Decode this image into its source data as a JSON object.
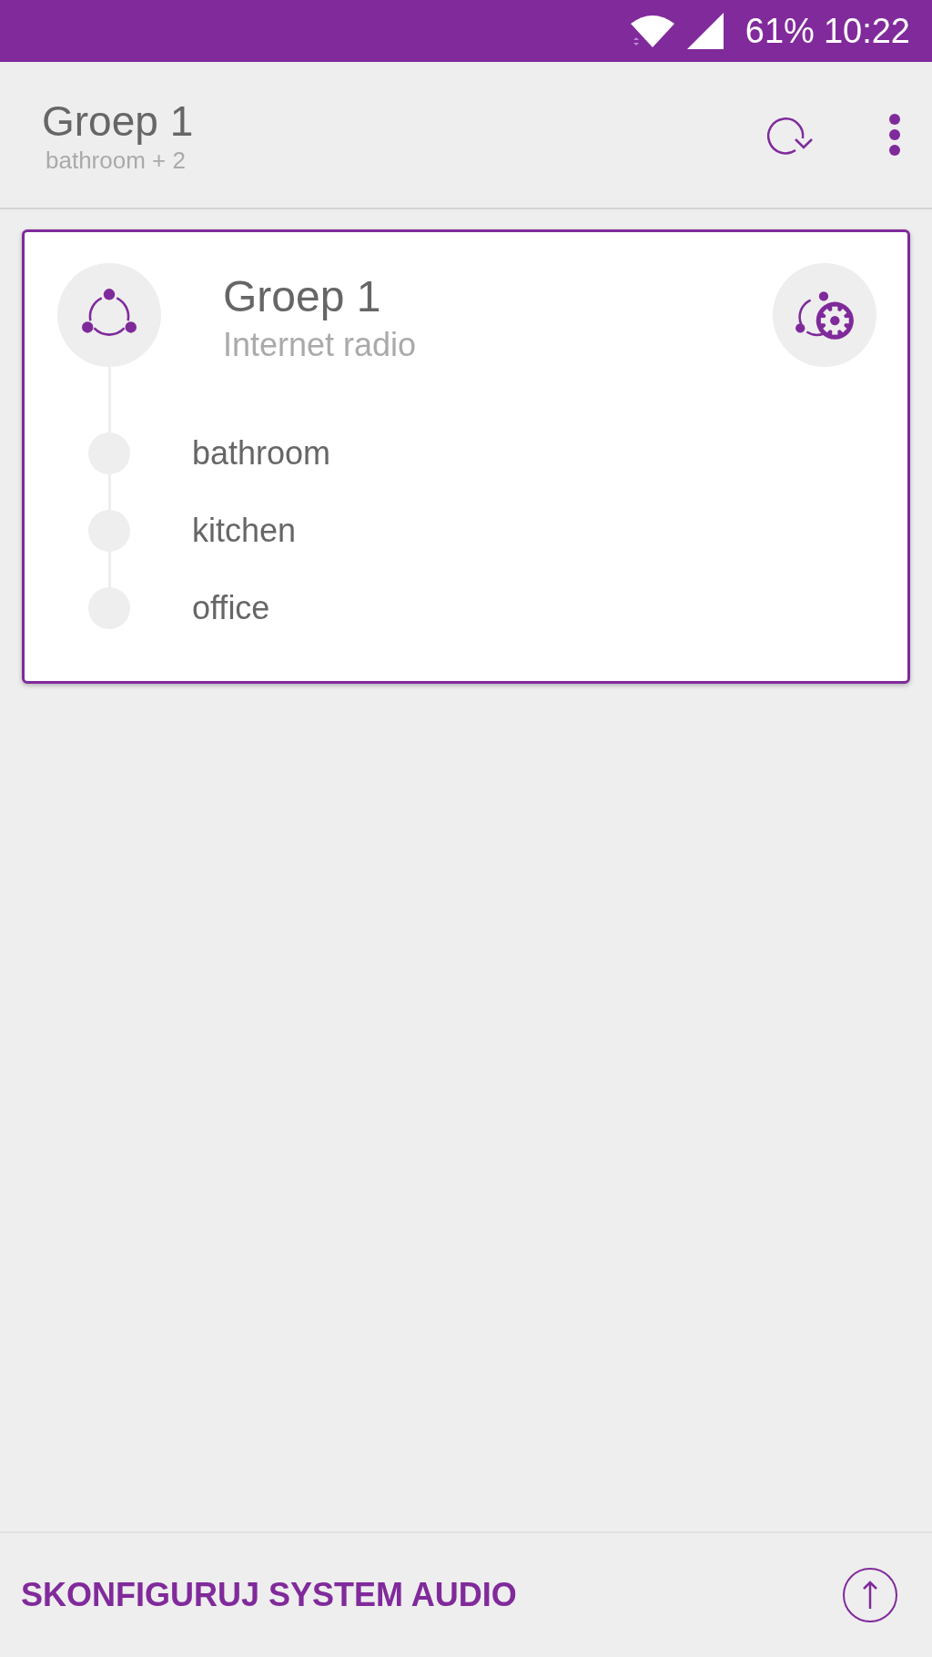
{
  "status_bar": {
    "battery": "61%",
    "time": "10:22"
  },
  "app_bar": {
    "title": "Groep 1",
    "subtitle": "bathroom + 2"
  },
  "group_card": {
    "title": "Groep 1",
    "subtitle": "Internet radio",
    "selected": true,
    "members": [
      {
        "name": "bathroom"
      },
      {
        "name": "kitchen"
      },
      {
        "name": "office"
      }
    ]
  },
  "bottom_bar": {
    "action": "SKONFIGURUJ SYSTEM AUDIO"
  }
}
